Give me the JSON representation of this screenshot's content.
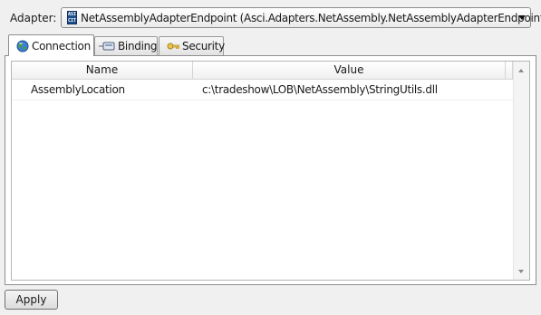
{
  "adapter": {
    "label": "Adapter:",
    "icon": "asci-adapter-icon",
    "icon_text": [
      "ASI",
      "CIT"
    ],
    "value": "NetAssemblyAdapterEndpoint (Asci.Adapters.NetAssembly.NetAssemblyAdapterEndpoint)"
  },
  "tabs": [
    {
      "label": "Connection",
      "icon": "globe-icon",
      "active": true
    },
    {
      "label": "Binding",
      "icon": "binding-icon",
      "active": false
    },
    {
      "label": "Security",
      "icon": "key-icon",
      "active": false
    }
  ],
  "grid": {
    "columns": [
      "Name",
      "Value"
    ],
    "rows": [
      {
        "name": "AssemblyLocation",
        "value": "c:\\tradeshow\\LOB\\NetAssembly\\StringUtils.dll"
      }
    ]
  },
  "buttons": {
    "apply": "Apply"
  }
}
